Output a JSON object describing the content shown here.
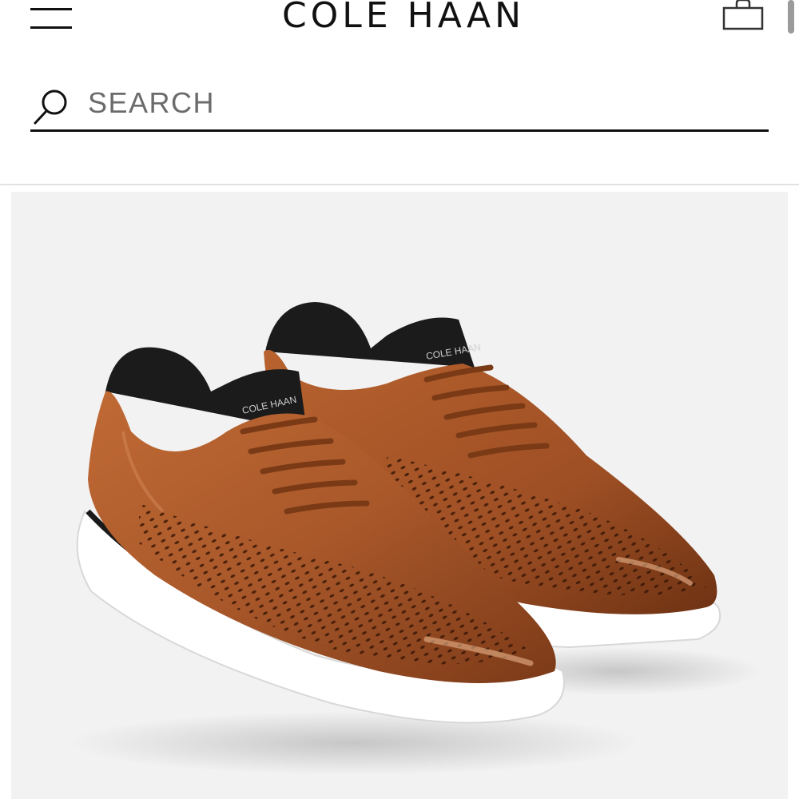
{
  "header": {
    "brand": "COLE HAAN",
    "menu_icon": "hamburger-menu-icon",
    "bag_icon": "shopping-bag-icon"
  },
  "search": {
    "placeholder": "SEARCH",
    "value": "",
    "icon": "search-icon"
  },
  "product": {
    "image_alt": "Brown perforated leather oxford sneakers with white soles",
    "shoe_brand_mark": "COLE HAAN"
  },
  "colors": {
    "text": "#111111",
    "placeholder": "#6b6b6b",
    "panel_bg": "#f2f2f2",
    "leather": "#a5532a",
    "sole": "#ffffff"
  }
}
